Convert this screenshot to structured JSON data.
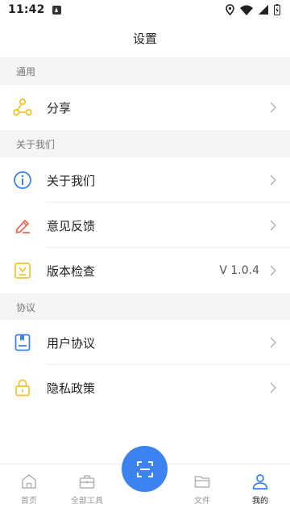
{
  "status_bar": {
    "time": "11:42"
  },
  "header": {
    "title": "设置"
  },
  "sections": {
    "general": {
      "title": "通用",
      "items": [
        {
          "label": "分享",
          "icon": "share-icon"
        }
      ]
    },
    "about": {
      "title": "关于我们",
      "items": [
        {
          "label": "关于我们",
          "icon": "info-icon"
        },
        {
          "label": "意见反馈",
          "icon": "feedback-pencil-icon"
        },
        {
          "label": "版本检查",
          "icon": "version-icon",
          "value": "V 1.0.4"
        }
      ]
    },
    "agreements": {
      "title": "协议",
      "items": [
        {
          "label": "用户协议",
          "icon": "user-agreement-icon"
        },
        {
          "label": "隐私政策",
          "icon": "privacy-lock-icon"
        }
      ]
    }
  },
  "bottom_nav": {
    "items": [
      {
        "label": "首页",
        "icon": "home-icon"
      },
      {
        "label": "全部工具",
        "icon": "toolbox-icon"
      },
      {
        "label": "文件",
        "icon": "folder-icon"
      },
      {
        "label": "我的",
        "icon": "profile-icon"
      }
    ],
    "active": "我的",
    "fab_icon": "scan-icon"
  },
  "colors": {
    "accent_blue": "#3c82f0",
    "share_yellow": "#f4c430",
    "info_blue": "#3c82f0",
    "feedback_red": "#e96a5a",
    "version_yellow": "#f4c430",
    "agreement_blue": "#3c82f0",
    "privacy_yellow": "#f4c430",
    "section_bg": "#f5f5f5"
  }
}
